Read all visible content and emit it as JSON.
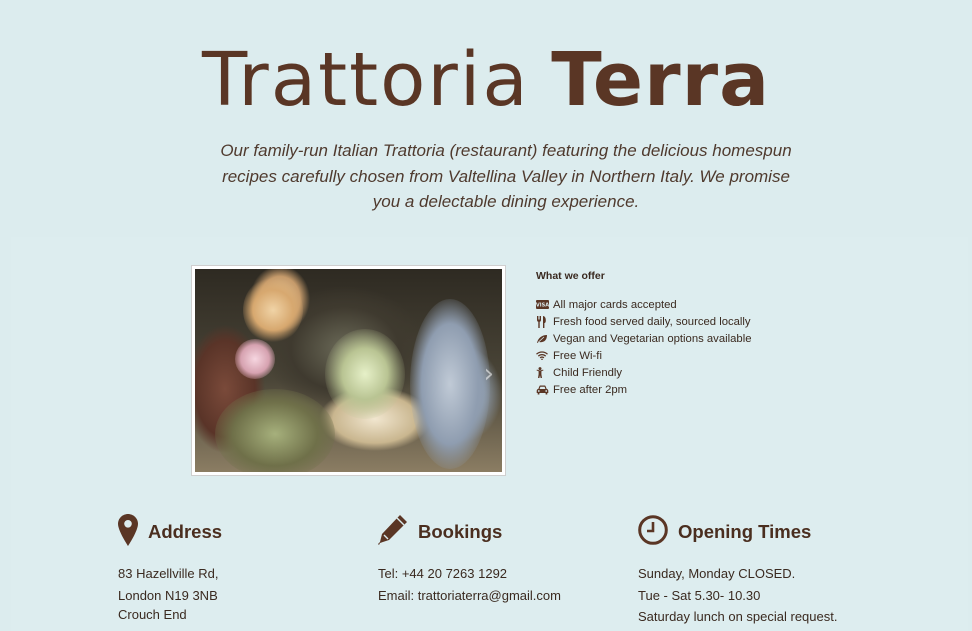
{
  "header": {
    "brand_light": "Trattoria",
    "brand_bold": "Terra",
    "tagline": "Our family-run Italian Trattoria (restaurant) featuring the delicious homespun recipes carefully chosen from Valtellina Valley in Northern Italy. We promise you a delectable dining experience."
  },
  "offer": {
    "title": "What we offer",
    "items": [
      {
        "icon": "credit-card-icon",
        "label": "All major cards accepted"
      },
      {
        "icon": "cutlery-icon",
        "label": "Fresh food served daily, sourced locally"
      },
      {
        "icon": "leaf-icon",
        "label": "Vegan and Vegetarian options available"
      },
      {
        "icon": "wifi-icon",
        "label": "Free Wi-fi"
      },
      {
        "icon": "child-icon",
        "label": "Child Friendly"
      },
      {
        "icon": "car-icon",
        "label": "Free after 2pm"
      }
    ]
  },
  "address": {
    "title": "Address",
    "icon": "map-pin-icon",
    "line1": "83 Hazellville Rd,",
    "line2": "London N19 3NB",
    "line3": "Crouch End"
  },
  "bookings": {
    "title": "Bookings",
    "icon": "pencil-icon",
    "phone": "Tel: +44 20 7263 1292",
    "email": "Email: trattoriaterra@gmail.com"
  },
  "opening": {
    "title": "Opening Times",
    "icon": "clock-icon",
    "line1": "Sunday, Monday CLOSED.",
    "line2": "Tue - Sat 5.30- 10.30",
    "line3": "Saturday lunch on special request."
  },
  "colors": {
    "background": "#dcecee",
    "brand": "#5a3625",
    "text": "#3a2a20"
  }
}
